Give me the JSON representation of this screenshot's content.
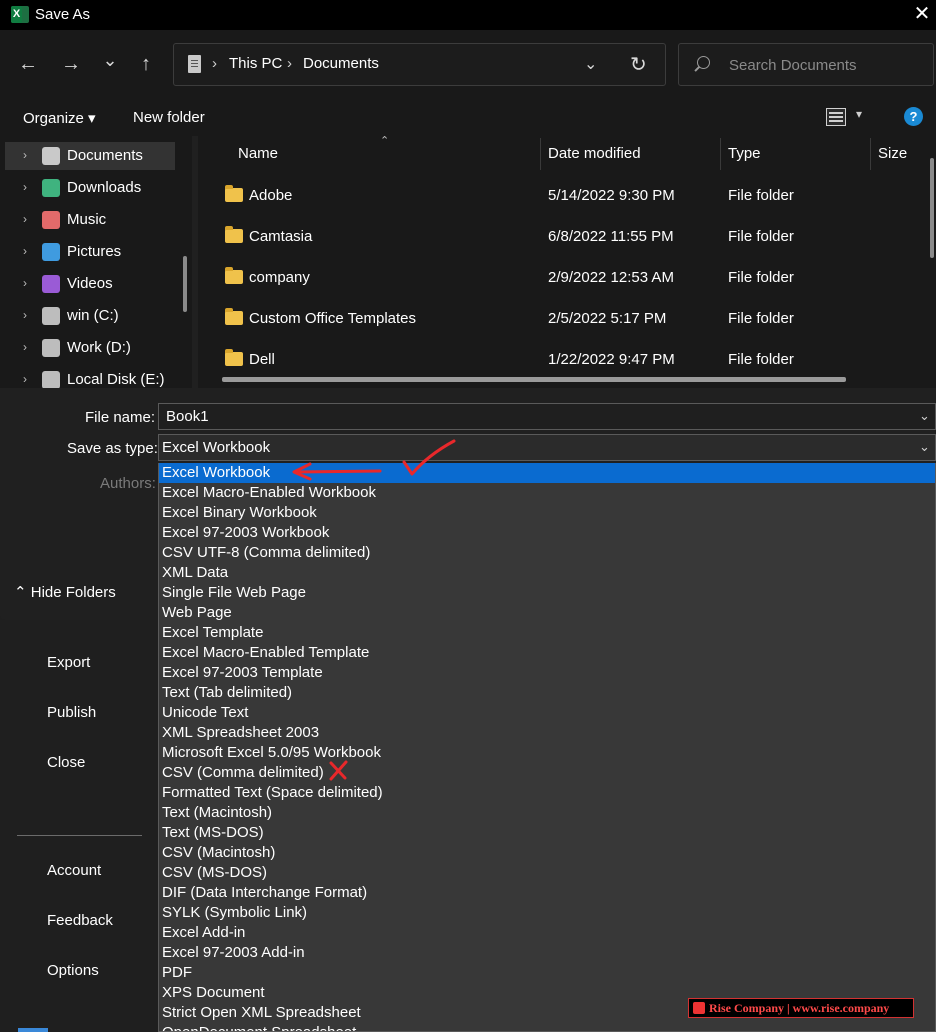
{
  "backstage": {
    "items": [
      "Export",
      "Publish",
      "Close",
      "Account",
      "Feedback",
      "Options"
    ]
  },
  "dialog": {
    "title": "Save As",
    "close_glyph": "✕",
    "nav": {
      "back_glyph": "←",
      "forward_glyph": "→",
      "recent_glyph": "⌄",
      "up_glyph": "↑"
    },
    "address": {
      "crumbs": [
        "This PC",
        "Documents"
      ],
      "sep_glyph": "›",
      "dropdown_glyph": "⌄",
      "refresh_glyph": "↻"
    },
    "search": {
      "placeholder": "Search Documents"
    },
    "toolbar": {
      "organize_label": "Organize ▾",
      "new_folder_label": "New folder",
      "view_chev": "▾",
      "help_glyph": "?"
    },
    "sidebar": {
      "items": [
        {
          "label": "Documents",
          "icon": "documents-icon",
          "color": "#c9c9c9",
          "selected": true
        },
        {
          "label": "Downloads",
          "icon": "download-icon",
          "color": "#3fb37f"
        },
        {
          "label": "Music",
          "icon": "music-icon",
          "color": "#e26a6a"
        },
        {
          "label": "Pictures",
          "icon": "pictures-icon",
          "color": "#3f9be0"
        },
        {
          "label": "Videos",
          "icon": "videos-icon",
          "color": "#9a5bd6"
        },
        {
          "label": "win (C:)",
          "icon": "drive-icon",
          "color": "#bdbdbd"
        },
        {
          "label": "Work (D:)",
          "icon": "drive-icon",
          "color": "#bdbdbd"
        },
        {
          "label": "Local Disk (E:)",
          "icon": "drive-icon",
          "color": "#bdbdbd"
        }
      ]
    },
    "columns": {
      "name": "Name",
      "date": "Date modified",
      "type": "Type",
      "size": "Size"
    },
    "files": [
      {
        "name": "Adobe",
        "date": "5/14/2022 9:30 PM",
        "type": "File folder"
      },
      {
        "name": "Camtasia",
        "date": "6/8/2022 11:55 PM",
        "type": "File folder"
      },
      {
        "name": "company",
        "date": "2/9/2022 12:53 AM",
        "type": "File folder"
      },
      {
        "name": "Custom Office Templates",
        "date": "2/5/2022 5:17 PM",
        "type": "File folder"
      },
      {
        "name": "Dell",
        "date": "1/22/2022 9:47 PM",
        "type": "File folder"
      }
    ],
    "form": {
      "file_name_label": "File name:",
      "file_name_value": "Book1",
      "save_type_label": "Save as type:",
      "save_type_value": "Excel Workbook",
      "authors_label": "Authors:",
      "hide_folders_label": "⌃ Hide Folders",
      "chev": "⌄"
    },
    "save_types": [
      "Excel Workbook",
      "Excel Macro-Enabled Workbook",
      "Excel Binary Workbook",
      "Excel 97-2003 Workbook",
      "CSV UTF-8 (Comma delimited)",
      "XML Data",
      "Single File Web Page",
      "Web Page",
      "Excel Template",
      "Excel Macro-Enabled Template",
      "Excel 97-2003 Template",
      "Text (Tab delimited)",
      "Unicode Text",
      "XML Spreadsheet 2003",
      "Microsoft Excel 5.0/95 Workbook",
      "CSV (Comma delimited)",
      "Formatted Text (Space delimited)",
      "Text (Macintosh)",
      "Text (MS-DOS)",
      "CSV (Macintosh)",
      "CSV (MS-DOS)",
      "DIF (Data Interchange Format)",
      "SYLK (Symbolic Link)",
      "Excel Add-in",
      "Excel 97-2003 Add-in",
      "PDF",
      "XPS Document",
      "Strict Open XML Spreadsheet",
      "OpenDocument Spreadsheet"
    ],
    "selected_save_type_index": 0
  },
  "annotations": {
    "color": "#e8282b",
    "check_mark": "✓",
    "cross_mark": "✗"
  },
  "watermark": {
    "text": "Rise Company | www.rise.company"
  }
}
